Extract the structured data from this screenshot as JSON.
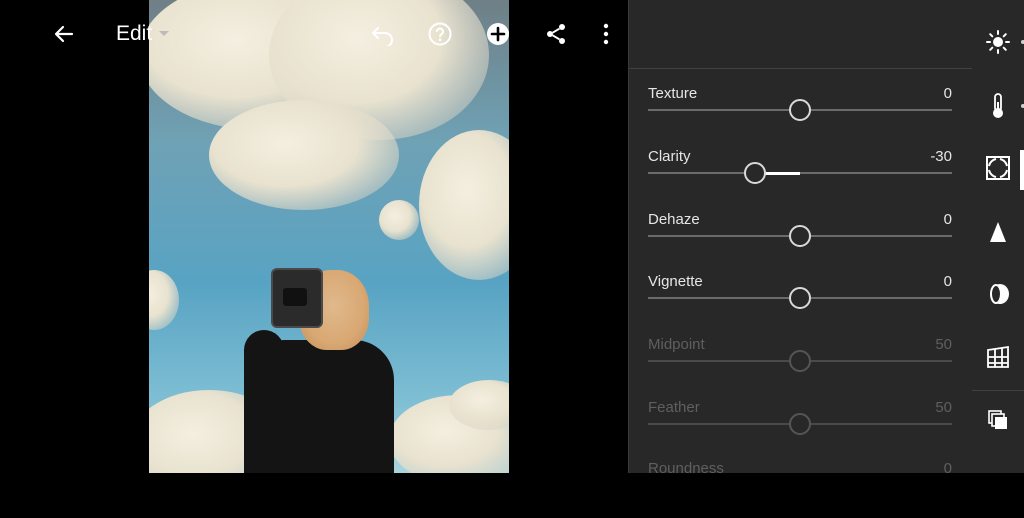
{
  "topbar": {
    "edit_label": "Edit"
  },
  "icons": {
    "back": "arrow-left-icon",
    "dropdown": "caret-down-icon",
    "undo": "undo-icon",
    "help": "help-circle-icon",
    "add": "plus-circle-icon",
    "share": "share-icon",
    "more": "more-vertical-icon"
  },
  "panel": {
    "sliders": [
      {
        "label": "Texture",
        "value": "0",
        "position": 0.5,
        "disabled": false
      },
      {
        "label": "Clarity",
        "value": "-30",
        "position": 0.35,
        "disabled": false
      },
      {
        "label": "Dehaze",
        "value": "0",
        "position": 0.5,
        "disabled": false
      },
      {
        "label": "Vignette",
        "value": "0",
        "position": 0.5,
        "disabled": false
      },
      {
        "label": "Midpoint",
        "value": "50",
        "position": 0.5,
        "disabled": true
      },
      {
        "label": "Feather",
        "value": "50",
        "position": 0.5,
        "disabled": true
      },
      {
        "label": "Roundness",
        "value": "0",
        "position": 0.5,
        "disabled": true
      }
    ]
  },
  "toolstrip": {
    "tools": [
      "light-icon",
      "color-icon",
      "effects-icon",
      "detail-icon",
      "optics-icon",
      "geometry-icon",
      "presets-icon"
    ],
    "active": "effects-icon"
  },
  "colors": {
    "panel_bg": "#282828",
    "track": "#6b6b6b",
    "fill": "#ffffff",
    "disabled_text": "#5f5f5f"
  }
}
